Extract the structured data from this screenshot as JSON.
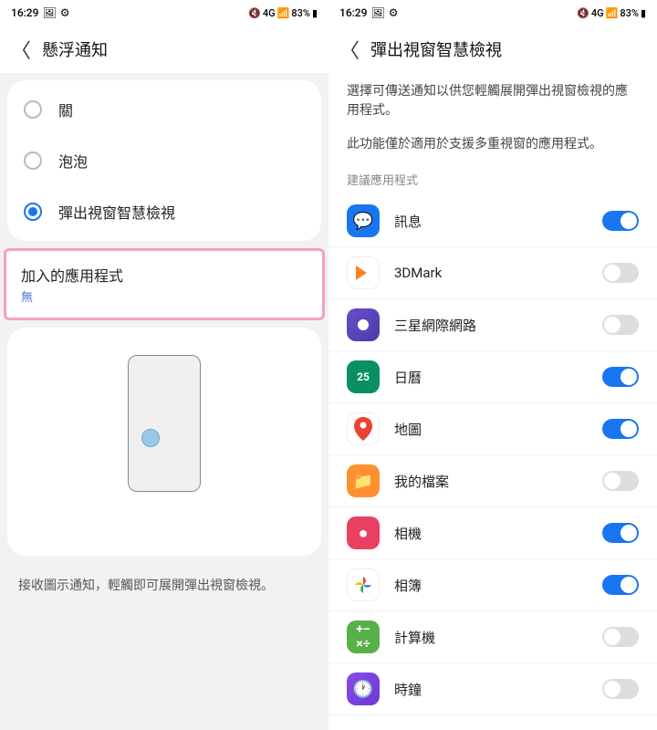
{
  "status": {
    "time": "16:29",
    "net": "4G",
    "signal": "📶",
    "battery_pct": "83%"
  },
  "left": {
    "title": "懸浮通知",
    "radios": {
      "off": "關",
      "bubble": "泡泡",
      "smartpop": "彈出視窗智慧檢視"
    },
    "highlight": {
      "title": "加入的應用程式",
      "sub": "無"
    },
    "helper": "接收圖示通知，輕觸即可展開彈出視窗檢視。"
  },
  "right": {
    "title": "彈出視窗智慧檢視",
    "desc1": "選擇可傳送通知以供您輕觸展開彈出視窗檢視的應用程式。",
    "desc2": "此功能僅於適用於支援多重視窗的應用程式。",
    "section": "建議應用程式",
    "apps": {
      "msg": "訊息",
      "m3d": "3DMark",
      "browser": "三星網際網路",
      "cal": "日曆",
      "maps": "地圖",
      "files": "我的檔案",
      "cam": "相機",
      "photos": "相簿",
      "calc": "計算機",
      "clock": "時鐘"
    }
  }
}
